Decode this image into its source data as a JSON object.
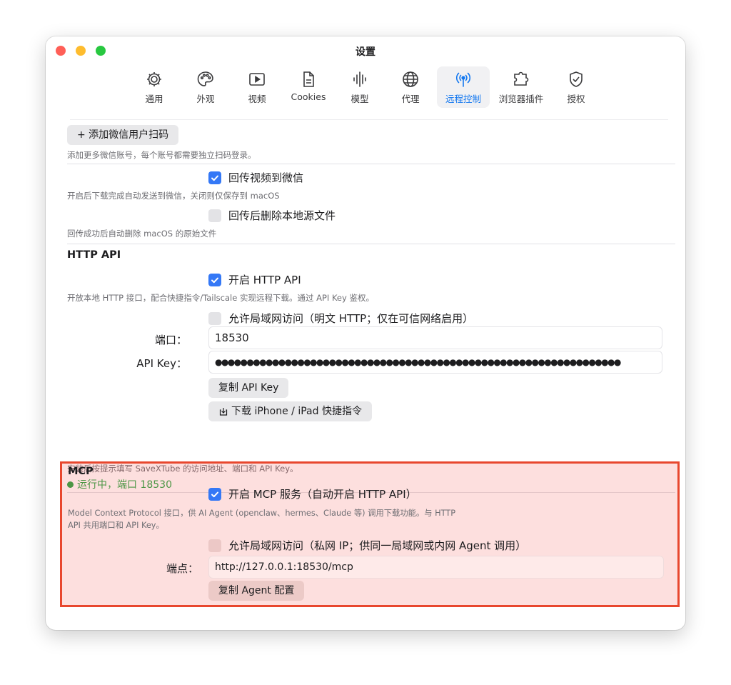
{
  "window": {
    "title": "设置"
  },
  "tabs": [
    {
      "label": "通用",
      "icon": "gear-icon"
    },
    {
      "label": "外观",
      "icon": "palette-icon"
    },
    {
      "label": "视频",
      "icon": "play-icon"
    },
    {
      "label": "Cookies",
      "icon": "document-icon"
    },
    {
      "label": "模型",
      "icon": "waveform-icon"
    },
    {
      "label": "代理",
      "icon": "globe-icon"
    },
    {
      "label": "远程控制",
      "icon": "antenna-icon",
      "active": true
    },
    {
      "label": "浏览器插件",
      "icon": "puzzle-icon"
    },
    {
      "label": "授权",
      "icon": "checkmark-shield-icon"
    }
  ],
  "wechat": {
    "add_button": "+ 添加微信用户扫码",
    "add_hint": "添加更多微信账号，每个账号都需要独立扫码登录。",
    "send_back": {
      "label": "回传视频到微信",
      "checked": true
    },
    "send_back_hint": "开启后下载完成自动发送到微信，关闭则仅保存到 macOS",
    "delete_local": {
      "label": "回传后删除本地源文件",
      "checked": false
    },
    "delete_local_hint": "回传成功后自动删除 macOS 的原始文件"
  },
  "http_api": {
    "section_title": "HTTP API",
    "enable": {
      "label": "开启 HTTP API",
      "checked": true
    },
    "enable_hint": "开放本地 HTTP 接口，配合快捷指令/Tailscale 实现远程下载。通过 API Key 鉴权。",
    "lan": {
      "label": "允许局域网访问（明文 HTTP；仅在可信网络启用）",
      "checked": false
    },
    "port_label": "端口：",
    "port_value": "18530",
    "apikey_label": "API Key：",
    "apikey_value": "●●●●●●●●●●●●●●●●●●●●●●●●●●●●●●●●●●●●●●●●●●●●●●●●●●●●●●●●●●●●●●●●",
    "copy_key_button": "复制 API Key",
    "download_shortcut_button": "下载 iPhone / iPad 快捷指令",
    "install_hint": "安装后按提示填写 SaveXTube 的访问地址、端口和 API Key。",
    "status": "运行中，端口 18530",
    "status_color": "#28a745"
  },
  "mcp": {
    "section_title": "MCP",
    "enable": {
      "label": "开启 MCP 服务（自动开启 HTTP API）",
      "checked": true
    },
    "desc_line1": "Model Context Protocol 接口，供 AI Agent (openclaw、hermes、Claude 等) 调用下载功能。与 HTTP",
    "desc_line2": "API 共用端口和 API Key。",
    "lan": {
      "label": "允许局域网访问（私网 IP；供同一局域网或内网 Agent 调用）",
      "checked": false
    },
    "endpoint_label": "端点：",
    "endpoint_value": "http://127.0.0.1:18530/mcp",
    "copy_config_button": "复制 Agent 配置"
  },
  "colors": {
    "accent": "#1478f0",
    "checkbox_on": "#3478f6",
    "highlight_border": "#e8472e"
  }
}
